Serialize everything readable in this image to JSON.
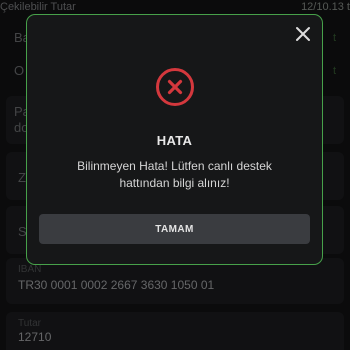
{
  "background": {
    "top_row": {
      "label": "Çekilebilir Tutar",
      "value": "12/10.13 t"
    },
    "partial_labels": [
      "Ba",
      "O",
      "Pa",
      "do",
      "Z",
      "S"
    ],
    "currency_symbol": "t",
    "iban": {
      "label": "IBAN",
      "value": "TR30 0001 0002 2667 3630 1050 01"
    },
    "amount": {
      "label": "Tutar",
      "value": "12710"
    }
  },
  "modal": {
    "title": "HATA",
    "message": "Bilinmeyen Hata! Lütfen canlı destek hattından bilgi alınız!",
    "ok_label": "TAMAM",
    "close_icon": "close-icon",
    "error_icon": "error-x-circle-icon",
    "colors": {
      "border": "#47a14a",
      "error": "#d4383d",
      "button_bg": "#3a3c40"
    }
  }
}
